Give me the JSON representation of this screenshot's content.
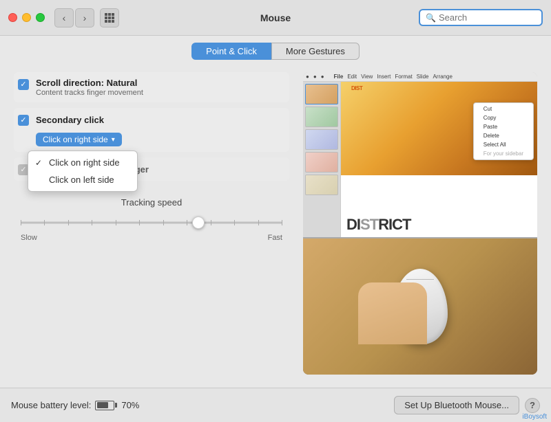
{
  "titlebar": {
    "title": "Mouse",
    "search_placeholder": "Search"
  },
  "tabs": [
    {
      "id": "point-click",
      "label": "Point & Click",
      "active": true
    },
    {
      "id": "more-gestures",
      "label": "More Gestures",
      "active": false
    }
  ],
  "settings": {
    "scroll": {
      "label": "Scroll direction: Natural",
      "sublabel": "Content tracks finger movement"
    },
    "secondary_click": {
      "label": "Secondary click",
      "dropdown_label": "Click on right side"
    },
    "dropdown_options": [
      {
        "label": "Click on right side",
        "checked": true
      },
      {
        "label": "Click on left side",
        "checked": false
      }
    ],
    "third": {
      "label": "Double-tap with one finger"
    }
  },
  "tracking": {
    "label": "Tracking speed",
    "slow_label": "Slow",
    "fast_label": "Fast"
  },
  "bottombar": {
    "battery_label": "Mouse battery level:",
    "battery_percent": "70%",
    "setup_btn": "Set Up Bluetooth Mouse...",
    "help_btn": "?"
  },
  "context_menu": {
    "items": [
      "Cut",
      "Copy",
      "Paste",
      "Delete",
      "Select All",
      "For your sidebar"
    ]
  },
  "district_text": "DISTRICT",
  "credit": "iBoysoft"
}
